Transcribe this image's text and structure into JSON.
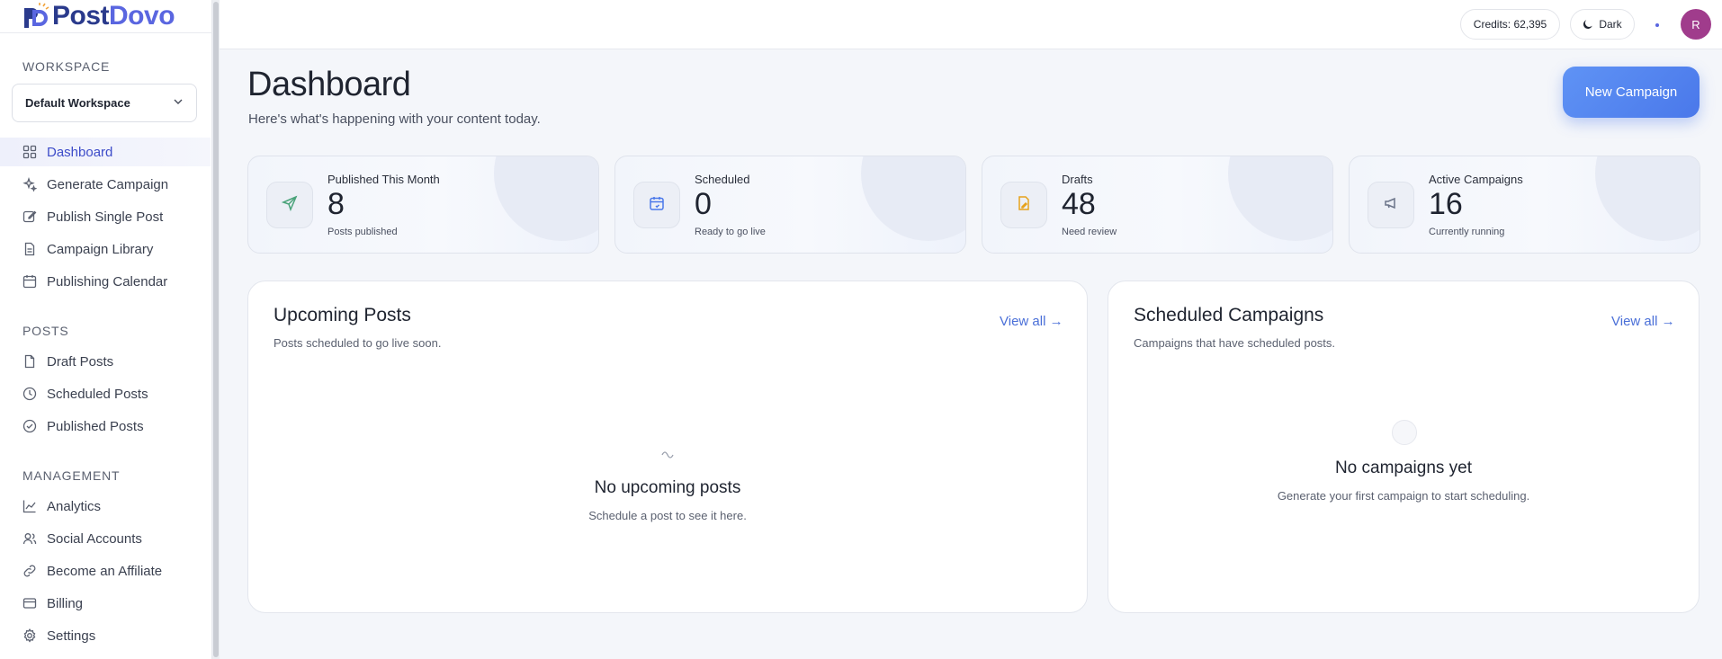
{
  "brand": {
    "name_part1": "Post",
    "name_part2": "Dovo"
  },
  "sidebar": {
    "workspace_label": "WORKSPACE",
    "workspace_value": "Default Workspace",
    "main_items": [
      {
        "label": "Dashboard",
        "icon": "grid-icon"
      },
      {
        "label": "Generate Campaign",
        "icon": "sparkle-icon"
      },
      {
        "label": "Publish Single Post",
        "icon": "edit-icon"
      },
      {
        "label": "Campaign Library",
        "icon": "document-icon"
      },
      {
        "label": "Publishing Calendar",
        "icon": "calendar-icon"
      }
    ],
    "posts_label": "POSTS",
    "posts_items": [
      {
        "label": "Draft Posts",
        "icon": "file-icon"
      },
      {
        "label": "Scheduled Posts",
        "icon": "clock-icon"
      },
      {
        "label": "Published Posts",
        "icon": "check-circle-icon"
      }
    ],
    "management_label": "MANAGEMENT",
    "management_items": [
      {
        "label": "Analytics",
        "icon": "chart-icon"
      },
      {
        "label": "Social Accounts",
        "icon": "users-icon"
      },
      {
        "label": "Become an Affiliate",
        "icon": "link-icon"
      },
      {
        "label": "Billing",
        "icon": "card-icon"
      },
      {
        "label": "Settings",
        "icon": "gear-icon"
      }
    ]
  },
  "topbar": {
    "credits": "Credits: 62,395",
    "theme_toggle": "Dark",
    "avatar_initial": "R"
  },
  "header": {
    "title": "Dashboard",
    "subtitle": "Here's what's happening with your content today.",
    "new_campaign_label": "New Campaign"
  },
  "stats": [
    {
      "label": "Published This Month",
      "value": "8",
      "sub": "Posts published",
      "icon": "send-icon",
      "color": "#4aa37a"
    },
    {
      "label": "Scheduled",
      "value": "0",
      "sub": "Ready to go live",
      "icon": "calendar-icon",
      "color": "#4a78ea"
    },
    {
      "label": "Drafts",
      "value": "48",
      "sub": "Need review",
      "icon": "file-edit-icon",
      "color": "#e6a21c"
    },
    {
      "label": "Active Campaigns",
      "value": "16",
      "sub": "Currently running",
      "icon": "megaphone-icon",
      "color": "#6a7388"
    }
  ],
  "upcoming": {
    "title": "Upcoming Posts",
    "subtitle": "Posts scheduled to go live soon.",
    "view_all": "View all →",
    "empty_title": "No upcoming posts",
    "empty_sub": "Schedule a post to see it here."
  },
  "campaigns": {
    "title": "Scheduled Campaigns",
    "subtitle": "Campaigns that have scheduled posts.",
    "view_all": "View all →",
    "empty_title": "No campaigns yet",
    "empty_sub": "Generate your first campaign to start scheduling."
  }
}
